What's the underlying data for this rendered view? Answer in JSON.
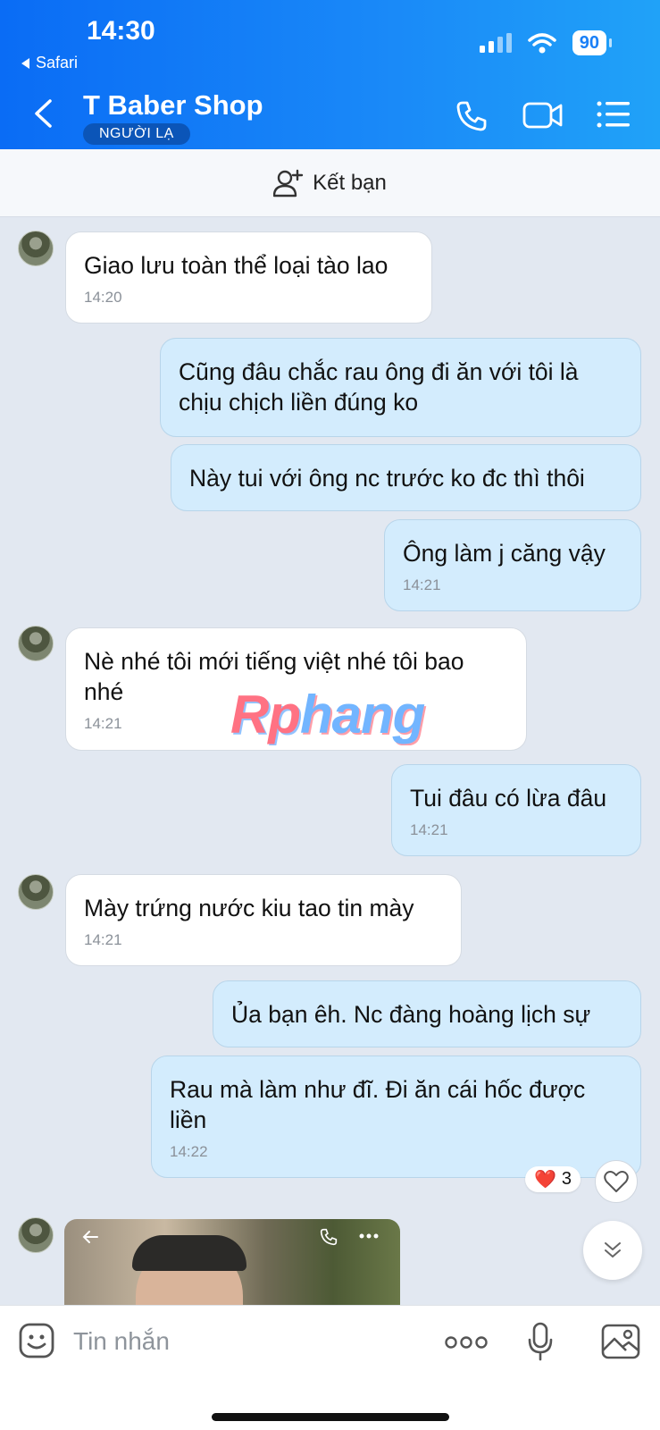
{
  "status_bar": {
    "time": "14:30",
    "back_app": "Safari",
    "battery": "90"
  },
  "header": {
    "title": "T Baber Shop",
    "badge": "NGƯỜI LẠ",
    "icons": [
      "back-icon",
      "phone-icon",
      "video-call-icon",
      "menu-list-icon"
    ]
  },
  "friend_bar": {
    "label": "Kết bạn"
  },
  "messages": [
    {
      "direction": "in",
      "text": "Giao lưu toàn thể loại tào lao",
      "time": "14:20"
    },
    {
      "direction": "out",
      "text": "Cũng đâu chắc rau ông đi ăn với tôi là chịu chịch liền đúng ko",
      "time": ""
    },
    {
      "direction": "out",
      "text": "Này tui với ông nc trước ko đc thì thôi",
      "time": ""
    },
    {
      "direction": "out",
      "text": "Ông làm j căng vậy",
      "time": "14:21"
    },
    {
      "direction": "in",
      "text": "Nè nhé tôi mới tiếng việt nhé tôi bao nhé",
      "time": "14:21"
    },
    {
      "direction": "out",
      "text": "Tui đâu có lừa đâu",
      "time": "14:21"
    },
    {
      "direction": "in",
      "text": "Mày trứng nước kiu tao tin mày",
      "time": "14:21"
    },
    {
      "direction": "out",
      "text": "Ủa bạn êh. Nc đàng hoàng lịch sự",
      "time": ""
    },
    {
      "direction": "out",
      "text": "Rau mà làm như đĩ. Đi ăn cái hốc được liền",
      "time": "14:22"
    }
  ],
  "reaction": {
    "emoji": "❤️",
    "count": "3"
  },
  "watermark": {
    "part1": "Rp",
    "part2": "hang"
  },
  "input_bar": {
    "placeholder": "Tin nhắn"
  },
  "colors": {
    "header_gradient_start": "#0a6cf5",
    "header_gradient_end": "#20a2f8",
    "outgoing_bubble": "#d3ecfd",
    "incoming_bubble": "#ffffff",
    "chat_background": "#e2e8f1"
  }
}
